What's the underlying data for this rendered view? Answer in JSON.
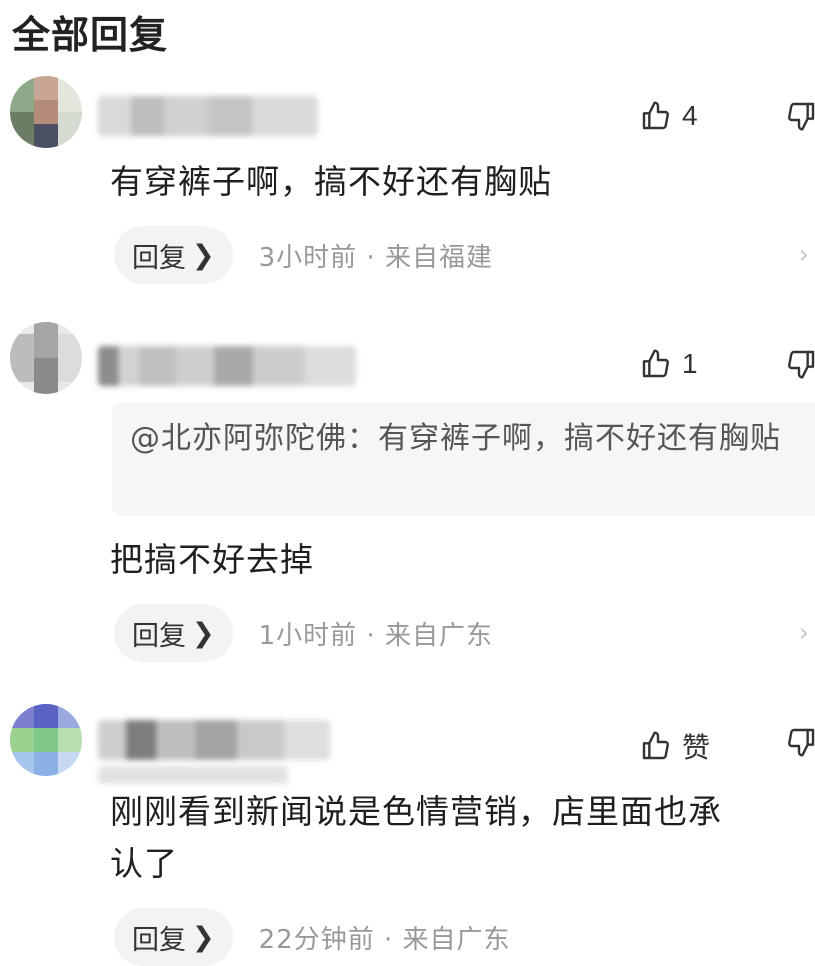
{
  "page_title": "全部回复",
  "comments": [
    {
      "likes": "4",
      "text": "有穿裤子啊，搞不好还有胸贴",
      "reply_label": "回复",
      "meta": "3小时前 · 来自福建"
    },
    {
      "likes": "1",
      "quote": "@北亦阿弥陀佛：有穿裤子啊，搞不好还有胸贴",
      "text": "把搞不好去掉",
      "reply_label": "回复",
      "meta": "1小时前 · 来自广东"
    },
    {
      "likes": "赞",
      "text_line1": "刚刚看到新闻说是色情营销，店里面也承",
      "text_line2": "认了",
      "reply_label": "回复",
      "meta": "22分钟前 · 来自广东"
    }
  ],
  "colors": {
    "text_primary": "#1f1f1f",
    "text_meta": "#999999",
    "reply_bg": "#f3f3f3",
    "quote_bg": "#f6f6f6"
  }
}
